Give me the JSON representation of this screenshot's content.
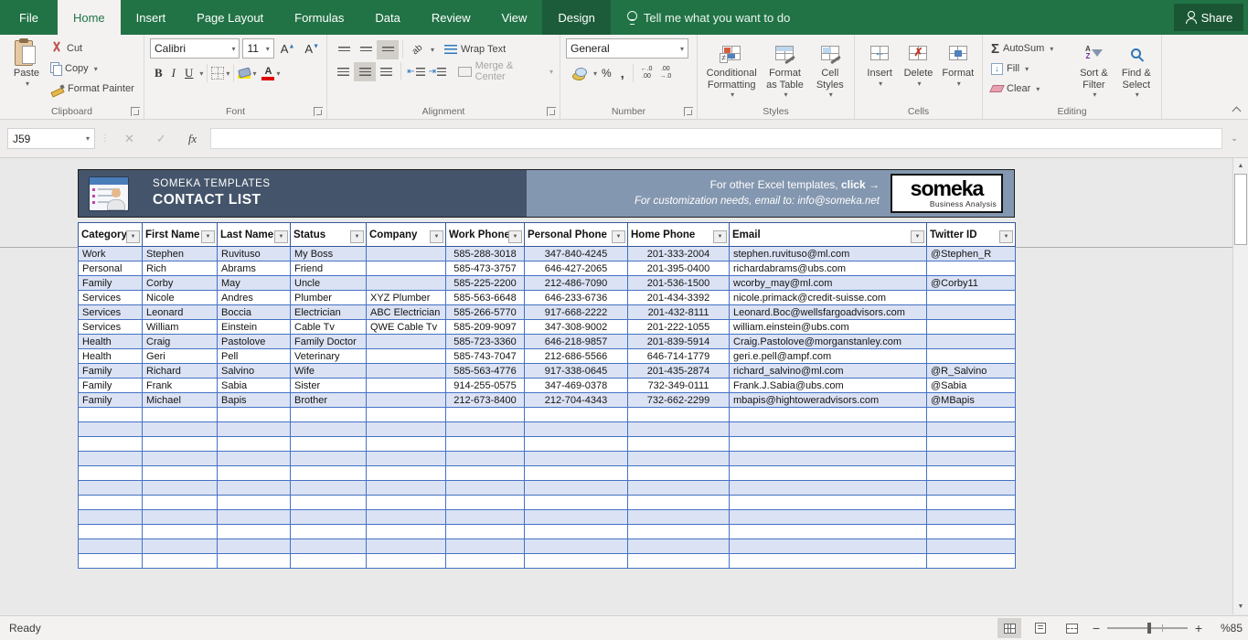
{
  "titlebar": {
    "tabs": [
      "File",
      "Home",
      "Insert",
      "Page Layout",
      "Formulas",
      "Data",
      "Review",
      "View",
      "Design"
    ],
    "tell_me": "Tell me what you want to do",
    "share": "Share"
  },
  "ribbon": {
    "group_labels": {
      "clipboard": "Clipboard",
      "font": "Font",
      "alignment": "Alignment",
      "number": "Number",
      "styles": "Styles",
      "cells": "Cells",
      "editing": "Editing"
    },
    "clipboard": {
      "paste": "Paste",
      "cut": "Cut",
      "copy": "Copy",
      "format_painter": "Format Painter"
    },
    "font": {
      "name": "Calibri",
      "size": "11",
      "bold": "B",
      "italic": "I",
      "underline": "U"
    },
    "alignment": {
      "wrap_text": "Wrap Text",
      "merge_center": "Merge & Center"
    },
    "number": {
      "format": "General",
      "percent": "%",
      "comma": ",",
      "inc_dec": "←.0\n.00",
      "dec_dec": ".00\n→.0"
    },
    "styles": {
      "conditional": "Conditional Formatting",
      "format_table": "Format as Table",
      "cell_styles": "Cell Styles"
    },
    "cells": {
      "insert": "Insert",
      "delete": "Delete",
      "format": "Format"
    },
    "editing": {
      "autosum": "AutoSum",
      "fill": "Fill",
      "clear": "Clear",
      "sort_filter": "Sort & Filter",
      "find_select": "Find & Select"
    }
  },
  "formula_bar": {
    "name_box": "J59",
    "fx": "fx",
    "value": ""
  },
  "sheet": {
    "banner": {
      "brand": "SOMEKA TEMPLATES",
      "title": "CONTACT LIST",
      "promo_line1_plain": "For other Excel templates, ",
      "promo_line1_bold": "click →",
      "promo_line2": "For customization needs, email to: info@someka.net",
      "logo_text": "someka",
      "logo_sub": "Business Analysis"
    },
    "table": {
      "columns": [
        "Category",
        "First Name",
        "Last Name",
        "Status",
        "Company",
        "Work Phone",
        "Personal Phone",
        "Home Phone",
        "Email",
        "Twitter ID"
      ],
      "rows": [
        [
          "Work",
          "Stephen",
          "Ruvituso",
          "My Boss",
          "",
          "585-288-3018",
          "347-840-4245",
          "201-333-2004",
          "stephen.ruvituso@ml.com",
          "@Stephen_R"
        ],
        [
          "Personal",
          "Rich",
          "Abrams",
          "Friend",
          "",
          "585-473-3757",
          "646-427-2065",
          "201-395-0400",
          "richardabrams@ubs.com",
          ""
        ],
        [
          "Family",
          "Corby",
          "May",
          "Uncle",
          "",
          "585-225-2200",
          "212-486-7090",
          "201-536-1500",
          "wcorby_may@ml.com",
          "@Corby11"
        ],
        [
          "Services",
          "Nicole",
          "Andres",
          "Plumber",
          "XYZ Plumber",
          "585-563-6648",
          "646-233-6736",
          "201-434-3392",
          "nicole.primack@credit-suisse.com",
          ""
        ],
        [
          "Services",
          "Leonard",
          "Boccia",
          "Electrician",
          "ABC Electrician",
          "585-266-5770",
          "917-668-2222",
          "201-432-8111",
          "Leonard.Boc@wellsfargoadvisors.com",
          ""
        ],
        [
          "Services",
          "William",
          "Einstein",
          "Cable Tv",
          "QWE Cable Tv",
          "585-209-9097",
          "347-308-9002",
          "201-222-1055",
          "william.einstein@ubs.com",
          ""
        ],
        [
          "Health",
          "Craig",
          "Pastolove",
          "Family Doctor",
          "",
          "585-723-3360",
          "646-218-9857",
          "201-839-5914",
          "Craig.Pastolove@morganstanley.com",
          ""
        ],
        [
          "Health",
          "Geri",
          "Pell",
          "Veterinary",
          "",
          "585-743-7047",
          "212-686-5566",
          "646-714-1779",
          "geri.e.pell@ampf.com",
          ""
        ],
        [
          "Family",
          "Richard",
          "Salvino",
          "Wife",
          "",
          "585-563-4776",
          "917-338-0645",
          "201-435-2874",
          "richard_salvino@ml.com",
          "@R_Salvino"
        ],
        [
          "Family",
          "Frank",
          "Sabia",
          "Sister",
          "",
          "914-255-0575",
          "347-469-0378",
          "732-349-0111",
          "Frank.J.Sabia@ubs.com",
          "@Sabia"
        ],
        [
          "Family",
          "Michael",
          "Bapis",
          "Brother",
          "",
          "212-673-8400",
          "212-704-4343",
          "732-662-2299",
          "mbapis@hightoweradvisors.com",
          "@MBapis"
        ]
      ],
      "empty_row_count": 11
    }
  },
  "status_bar": {
    "ready": "Ready",
    "zoom": "%85"
  },
  "colors": {
    "excel_green": "#217346",
    "contextual_tab_green": "#1c5c3a",
    "banner_dark": "#44546a",
    "banner_light": "#8497b0",
    "table_border": "#4472c4",
    "band_fill": "#dbe2f4"
  }
}
